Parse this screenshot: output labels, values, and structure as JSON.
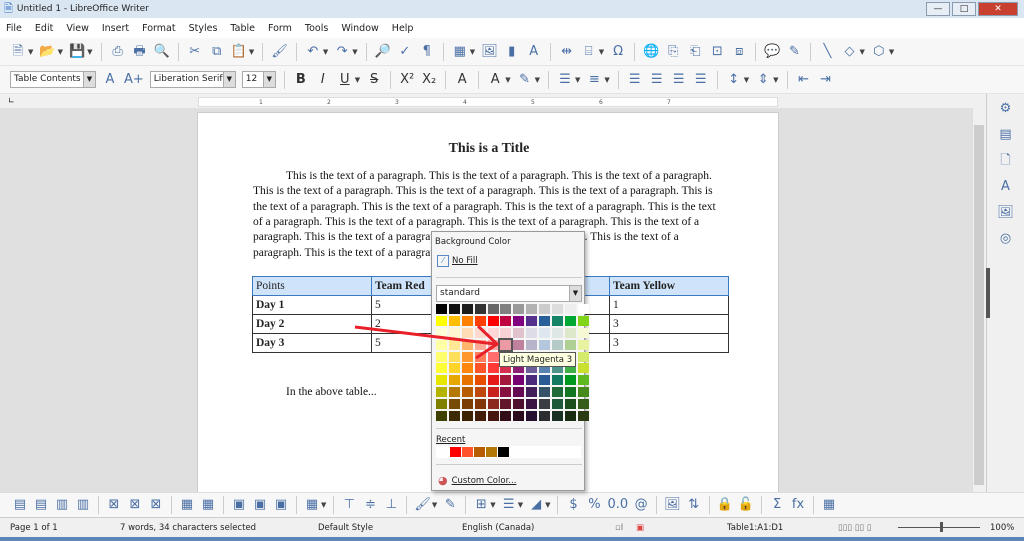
{
  "window": {
    "title": "Untitled 1 - LibreOffice Writer",
    "min": "—",
    "max": "□",
    "close": "✕"
  },
  "menu": [
    "File",
    "Edit",
    "View",
    "Insert",
    "Format",
    "Styles",
    "Table",
    "Form",
    "Tools",
    "Window",
    "Help"
  ],
  "toolbar1": [
    [
      "new-document",
      "🗎",
      1
    ],
    [
      "open",
      "📂",
      1
    ],
    [
      "save",
      "💾",
      1
    ],
    [
      "sep"
    ],
    [
      "export-pdf",
      "⎙"
    ],
    [
      "print",
      "🖶"
    ],
    [
      "print-preview",
      "🔍"
    ],
    [
      "sep"
    ],
    [
      "cut",
      "✂"
    ],
    [
      "copy",
      "⧉"
    ],
    [
      "paste",
      "📋",
      1
    ],
    [
      "sep"
    ],
    [
      "clone-formatting",
      "🖌"
    ],
    [
      "sep"
    ],
    [
      "undo",
      "↶",
      1
    ],
    [
      "redo",
      "↷",
      1
    ],
    [
      "sep"
    ],
    [
      "find-replace",
      "🔎"
    ],
    [
      "spellcheck",
      "✓"
    ],
    [
      "formatting-marks",
      "¶"
    ],
    [
      "sep"
    ],
    [
      "insert-table",
      "▦",
      1
    ],
    [
      "insert-image",
      "🖼"
    ],
    [
      "insert-chart",
      "▮"
    ],
    [
      "insert-textbox",
      "A"
    ],
    [
      "sep"
    ],
    [
      "page-break",
      "⇹"
    ],
    [
      "insert-field",
      "⌸",
      1
    ],
    [
      "special-character",
      "Ω"
    ],
    [
      "sep"
    ],
    [
      "hyperlink",
      "🌐"
    ],
    [
      "footnote",
      "⎘"
    ],
    [
      "endnote",
      "⎗"
    ],
    [
      "bookmark",
      "⊡"
    ],
    [
      "cross-reference",
      "⧈"
    ],
    [
      "sep"
    ],
    [
      "comment",
      "💬"
    ],
    [
      "track-changes",
      "✎"
    ],
    [
      "sep"
    ],
    [
      "line",
      "╲"
    ],
    [
      "basic-shapes",
      "◇",
      1
    ],
    [
      "draw-functions",
      "⬡",
      1
    ]
  ],
  "toolbar2": {
    "paragraph_style": "Table Contents",
    "font_name": "Liberation Serif",
    "font_size": "12",
    "icons": [
      [
        "sep"
      ],
      [
        "bold",
        "B"
      ],
      [
        "italic",
        "I"
      ],
      [
        "underline",
        "U",
        1
      ],
      [
        "strikethrough",
        "S"
      ],
      [
        "sep"
      ],
      [
        "superscript",
        "X²"
      ],
      [
        "subscript",
        "X₂"
      ],
      [
        "sep"
      ],
      [
        "clear-formatting",
        "A"
      ],
      [
        "sep"
      ],
      [
        "font-color",
        "A",
        1
      ],
      [
        "highlight-color",
        "✎",
        1
      ],
      [
        "sep"
      ],
      [
        "bullets",
        "☰",
        1
      ],
      [
        "numbering",
        "≡",
        1
      ],
      [
        "sep"
      ],
      [
        "align-left",
        "☰"
      ],
      [
        "align-center",
        "☰"
      ],
      [
        "align-right",
        "☰"
      ],
      [
        "justify",
        "☰"
      ],
      [
        "sep"
      ],
      [
        "line-spacing",
        "↕",
        1
      ],
      [
        "paragraph-spacing",
        "⇕",
        1
      ],
      [
        "sep"
      ],
      [
        "decrease-indent",
        "⇤"
      ],
      [
        "increase-indent",
        "⇥"
      ]
    ]
  },
  "ruler": {
    "ticks": [
      "1",
      "2",
      "3",
      "4",
      "5",
      "6",
      "7"
    ]
  },
  "document": {
    "title": "This is a Title",
    "lines": [
      "This is the text of a paragraph.  This is the text of a paragraph.  This is the text of a paragraph.",
      "This is the text of a paragraph.  This is the text of a paragraph.  This is the text of a paragraph.  This is",
      "the text of a paragraph.  This is the text of a paragraph.  This is the text of a paragraph.  This is the text",
      "of a paragraph.  This is the text of a paragraph.  This is the text of a paragraph.  This is the text of a",
      "paragraph.  This is the text of a paragraph.  This is the text of a paragraph.  This is the text of a",
      "paragraph.  This is the text of a paragraph."
    ],
    "table": {
      "headers": [
        "Points",
        "Team Red",
        "",
        "Team Yellow"
      ],
      "rows": [
        [
          "Day 1",
          "5",
          "",
          "1"
        ],
        [
          "Day 2",
          "2",
          "",
          "3"
        ],
        [
          "Day 3",
          "5",
          "",
          "3"
        ]
      ]
    },
    "after": "In the above table..."
  },
  "popup": {
    "title": "Background Color",
    "no_fill": "No Fill",
    "palette": "standard",
    "recent_label": "Recent",
    "custom": "Custom Color...",
    "tooltip": "Light Magenta 3",
    "colors": [
      "#000000",
      "#111111",
      "#1c1c1c",
      "#333333",
      "#666666",
      "#808080",
      "#999999",
      "#b2b2b2",
      "#cccccc",
      "#dddddd",
      "#eeeeee",
      "#ffffff",
      "#ffff00",
      "#ffbf00",
      "#ff8000",
      "#ff4000",
      "#ff0000",
      "#bf0041",
      "#800080",
      "#55308d",
      "#2a6099",
      "#158466",
      "#00a933",
      "#81d41a",
      "#ffffd7",
      "#fff5ce",
      "#ffdbb6",
      "#ffd8ce",
      "#ffd7d7",
      "#f7d1d5",
      "#e0c2cd",
      "#dedce6",
      "#dee6ef",
      "#dee7e5",
      "#dde8cb",
      "#f6f9d4",
      "#ffffa6",
      "#ffe994",
      "#ffb66c",
      "#ffaa95",
      "#ffa6a6",
      "#ec9ba4",
      "#bf819e",
      "#b7b3ca",
      "#b4c7dc",
      "#b3cac7",
      "#afd095",
      "#e8f2a1",
      "#ffff6d",
      "#ffde59",
      "#ff972f",
      "#ff7b59",
      "#ff6d6d",
      "#e16173",
      "#a1467e",
      "#8e86ae",
      "#729fcf",
      "#81aca6",
      "#77bc65",
      "#d4ea6b",
      "#ffff38",
      "#ffd428",
      "#ff860d",
      "#ff5429",
      "#ff3838",
      "#d62e4e",
      "#8d1d75",
      "#6b5e9b",
      "#5983b0",
      "#50938a",
      "#3faf46",
      "#c9e12e",
      "#e6e600",
      "#e6a800",
      "#e67300",
      "#e64d00",
      "#e61919",
      "#a5183e",
      "#770070",
      "#4b2a7c",
      "#2a5b94",
      "#127a5e",
      "#00991f",
      "#5eb91e",
      "#b3b300",
      "#b47804",
      "#b85c00",
      "#be480a",
      "#c9211e",
      "#861141",
      "#650953",
      "#43205c",
      "#355269",
      "#1e6a39",
      "#127622",
      "#468a1a",
      "#7f7f00",
      "#784b04",
      "#7b3d00",
      "#813709",
      "#8d281e",
      "#611729",
      "#4e102d",
      "#3b1443",
      "#3a3e42",
      "#1e5a3a",
      "#1c4d1c",
      "#355d1a",
      "#404000",
      "#3d2904",
      "#3e2100",
      "#421c08",
      "#471510",
      "#320c16",
      "#2a0a1c",
      "#261031",
      "#2a2c30",
      "#1a3225",
      "#192c12",
      "#2a3a12"
    ],
    "selected_index": 41,
    "recent": [
      "#ffffff",
      "#ff0000",
      "#ff5429",
      "#b85c00",
      "#b47804",
      "#000000"
    ]
  },
  "bottom_toolbar": [
    [
      "insert-row-above",
      "▤"
    ],
    [
      "insert-row-below",
      "▤"
    ],
    [
      "insert-column-before",
      "▥"
    ],
    [
      "insert-column-after",
      "▥"
    ],
    [
      "sep"
    ],
    [
      "delete-rows",
      "⊠"
    ],
    [
      "delete-columns",
      "⊠"
    ],
    [
      "delete-table",
      "⊠"
    ],
    [
      "sep"
    ],
    [
      "select-cell",
      "▦"
    ],
    [
      "select-table",
      "▦"
    ],
    [
      "sep"
    ],
    [
      "merge-cells",
      "▣"
    ],
    [
      "split-cells",
      "▣"
    ],
    [
      "split-table",
      "▣"
    ],
    [
      "sep"
    ],
    [
      "autoformat",
      "▦",
      1
    ],
    [
      "sep"
    ],
    [
      "align-top",
      "⊤"
    ],
    [
      "center-vertically",
      "≑"
    ],
    [
      "align-bottom",
      "⊥"
    ],
    [
      "sep"
    ],
    [
      "table-cell-background",
      "🖌",
      1
    ],
    [
      "borders-edit",
      "✎"
    ],
    [
      "sep"
    ],
    [
      "borders",
      "⊞",
      1
    ],
    [
      "border-style",
      "☰",
      1
    ],
    [
      "border-color",
      "◢",
      1
    ],
    [
      "sep"
    ],
    [
      "currency-format",
      "$"
    ],
    [
      "percent-format",
      "%"
    ],
    [
      "number-format",
      "0.0"
    ],
    [
      "number-format-dialog",
      "@"
    ],
    [
      "sep"
    ],
    [
      "insert-caption",
      "🖼"
    ],
    [
      "sort",
      "⇅"
    ],
    [
      "sep"
    ],
    [
      "protect-cells",
      "🔒"
    ],
    [
      "unprotect-cells",
      "🔓"
    ],
    [
      "sep"
    ],
    [
      "sum",
      "Σ"
    ],
    [
      "formula",
      "fx"
    ],
    [
      "sep"
    ],
    [
      "table-properties",
      "▦"
    ]
  ],
  "status": {
    "page": "Page 1 of 1",
    "words": "7 words, 34 characters selected",
    "style": "Default Style",
    "language": "English (Canada)",
    "cell": "Table1:A1:D1",
    "zoom": "100%"
  },
  "sidebar": [
    "properties-icon",
    "styles-icon",
    "page-icon",
    "gallery-icon",
    "navigator-icon",
    "manage-changes-icon"
  ]
}
